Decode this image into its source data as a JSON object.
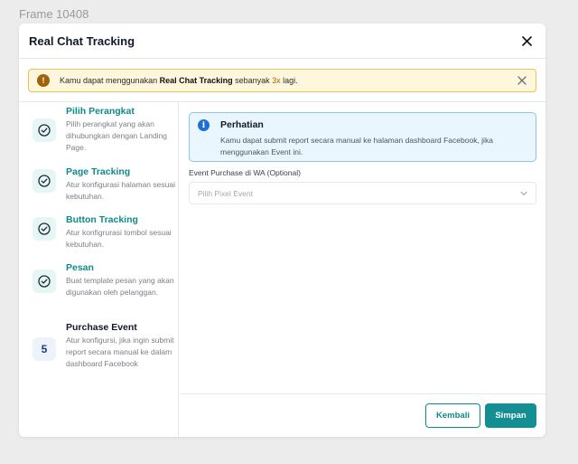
{
  "frame_label": "Frame 10408",
  "modal": {
    "title": "Real Chat Tracking",
    "close_icon": "close-icon"
  },
  "alert": {
    "text_before": "Kamu dapat menggunakan ",
    "bold_text": "Real Chat Tracking",
    "text_middle": " sebanyak ",
    "count": "3x",
    "text_after": " lagi.",
    "icon": "warning-icon",
    "close_icon": "close-icon"
  },
  "steps": [
    {
      "title": "Pilih Perangkat",
      "desc": "Pilih perangkat yang akan dihubungkan dengan Landing Page.",
      "status": "done",
      "icon": "check-circle-icon"
    },
    {
      "title": "Page Tracking",
      "desc": "Atur konfigurasi halaman sesuai kebutuhan.",
      "status": "done",
      "icon": "check-circle-icon"
    },
    {
      "title": "Button Tracking",
      "desc": "Atur konfigrurasi tombol sesuai kebutuhan.",
      "status": "done",
      "icon": "check-circle-icon"
    },
    {
      "title": "Pesan",
      "desc": "Buat template pesan yang akan digunakan oleh pelanggan.",
      "status": "done",
      "icon": "check-circle-icon"
    },
    {
      "title": "Purchase Event",
      "desc": "Atur konfigursi, jika ingin submit report secara manual ke dalam dashboard Facebook",
      "status": "active",
      "number": "5"
    }
  ],
  "info": {
    "title": "Perhatian",
    "text": "Kamu dapat submit report secara manual ke halaman dashboard Facebook, jika menggunakan Event ini.",
    "icon": "info-icon"
  },
  "field": {
    "label": "Event Purchase di WA (Optional)",
    "placeholder": "Pilih  Pixel Event",
    "icon": "chevron-down-icon"
  },
  "buttons": {
    "back": "Kembali",
    "save": "Simpan"
  },
  "colors": {
    "accent": "#0f8a8a",
    "primary_button": "#138f93",
    "alert_bg": "#fef7dc",
    "alert_border": "#e8c25a",
    "info_bg": "#eaf6fd",
    "info_border": "#8cc6e3",
    "info_icon": "#1d6fd6"
  }
}
